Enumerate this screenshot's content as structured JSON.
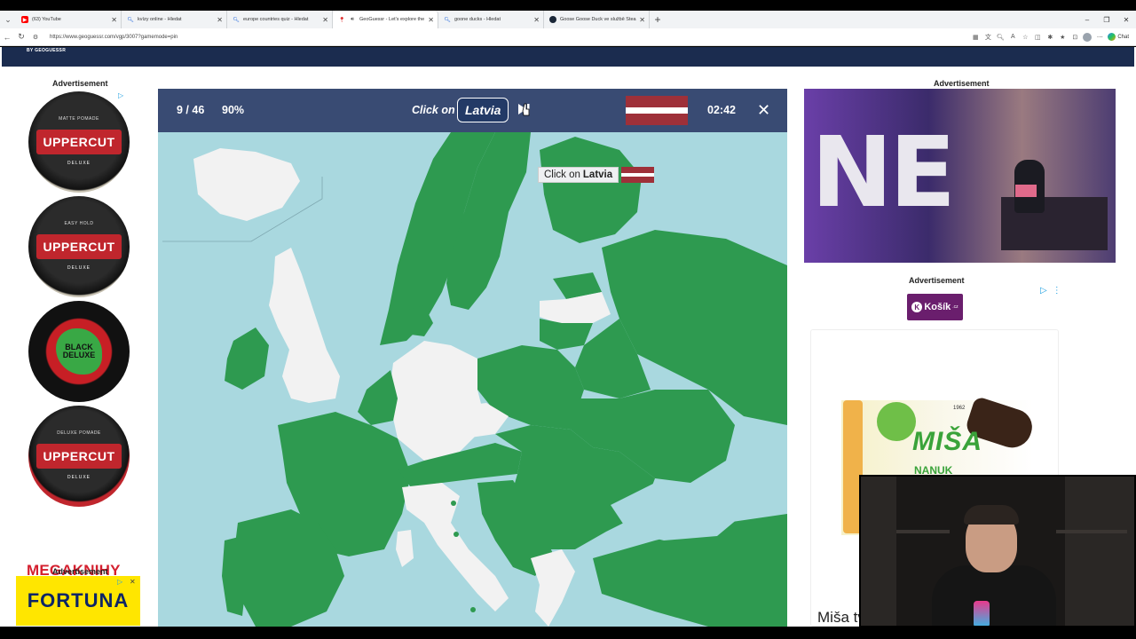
{
  "browser": {
    "tabs": [
      {
        "title": "(63) YouTube",
        "fav_color": "#ff0000",
        "active": false
      },
      {
        "title": "kvízy online - Hledat",
        "fav_color": "#2b6de0",
        "active": false
      },
      {
        "title": "europe countries quiz - Hledat",
        "fav_color": "#2b6de0",
        "active": false
      },
      {
        "title": "GeoGuessr - Let's explore the",
        "fav_color": "#d22",
        "active": true
      },
      {
        "title": "goone ducks - Hledat",
        "fav_color": "#2b6de0",
        "active": false
      },
      {
        "title": "Goose Goose Duck ve službě Stea",
        "fav_color": "#1b2838",
        "active": false
      }
    ],
    "url": "https://www.geoguessr.com/vgp/3007?gamemode=pin",
    "chat_label": "Chat"
  },
  "site": {
    "brand_prefix": "BY",
    "brand": "GEOGUESSR"
  },
  "ads": {
    "label": "Advertisement",
    "left": {
      "tin1": {
        "band": "UPPERCUT",
        "sub": "MATTE POMADE",
        "deluxe": "DELUXE"
      },
      "tin2": {
        "band": "UPPERCUT",
        "sub": "EASY HOLD",
        "deluxe": "DELUXE"
      },
      "tin3": {
        "croc": "BLACK DELUXE"
      },
      "tin4": {
        "band": "UPPERCUT",
        "sub": "DELUXE POMADE",
        "deluxe": "DELUXE"
      },
      "megaknihy": "MEGAKNIHY",
      "fortuna": "FORTUNA"
    },
    "right": {
      "video_text": "NE",
      "kosik": "Košík",
      "kosik_tld": ".cz",
      "misa_logo": "MIŠA",
      "misa_year": "1962",
      "misa_nanuk": "NANUK",
      "misa_title": "Miša tv"
    }
  },
  "game": {
    "score": "9 / 46",
    "accuracy": "90%",
    "prompt": "Click on",
    "target": "Latvia",
    "timer": "02:42",
    "tooltip_prefix": "Click on",
    "tooltip_target": "Latvia",
    "flag_colors": {
      "red": "#9e3039",
      "white": "#ffffff"
    },
    "colors": {
      "sea": "#a9d8df",
      "found": "#2e9a50",
      "remaining": "#f2f2f2",
      "bar": "#394b73"
    }
  }
}
